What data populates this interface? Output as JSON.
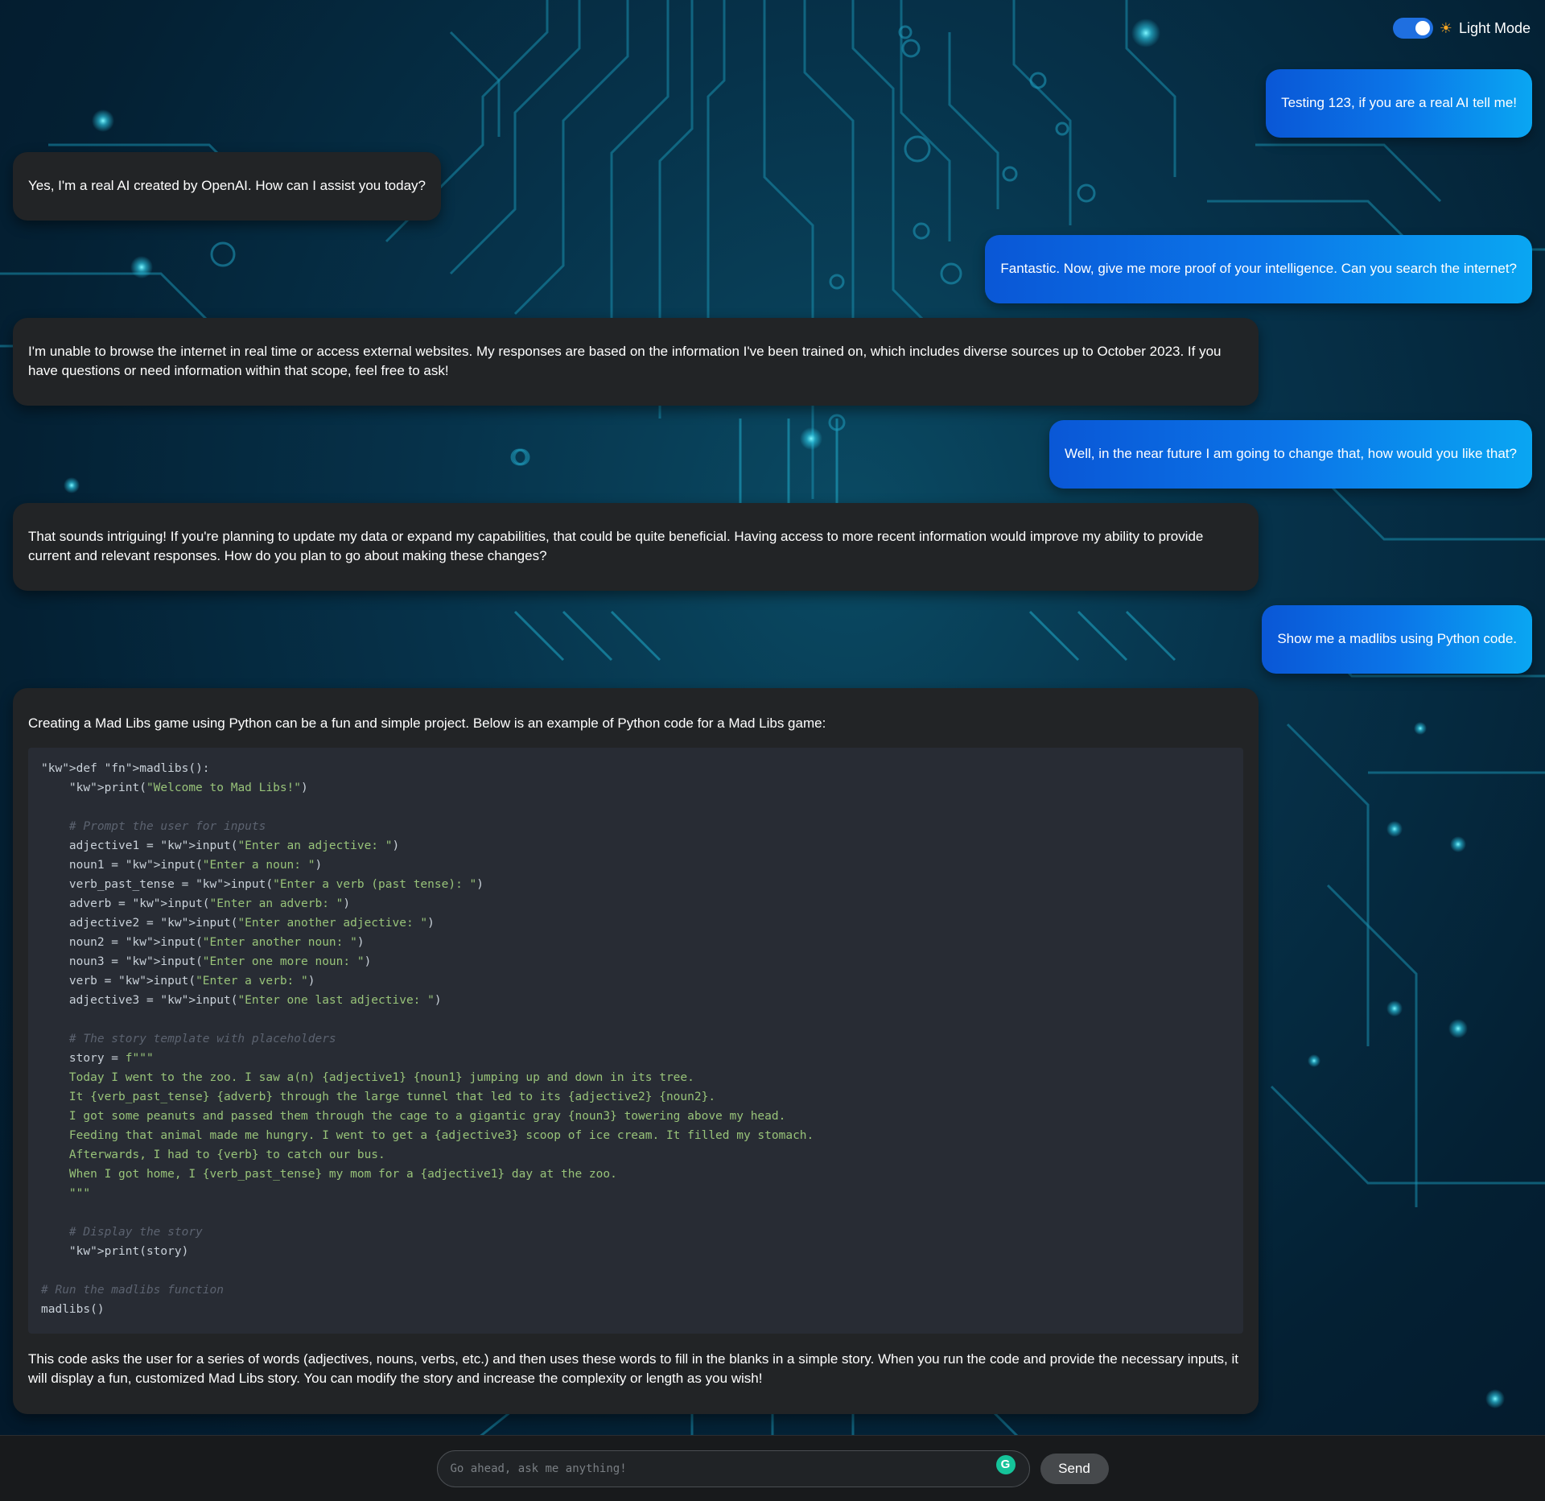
{
  "theme_toggle": {
    "label": "Light Mode",
    "enabled": true,
    "icon": "sun-icon"
  },
  "messages": [
    {
      "role": "user",
      "text": "Testing 123, if you are a real AI tell me!"
    },
    {
      "role": "assistant",
      "text": "Yes, I'm a real AI created by OpenAI. How can I assist you today?"
    },
    {
      "role": "user",
      "text": "Fantastic. Now, give me more proof of your intelligence. Can you search the internet?"
    },
    {
      "role": "assistant",
      "text": "I'm unable to browse the internet in real time or access external websites. My responses are based on the information I've been trained on, which includes diverse sources up to October 2023. If you have questions or need information within that scope, feel free to ask!"
    },
    {
      "role": "user",
      "text": "Well, in the near future I am going to change that, how would you like that?"
    },
    {
      "role": "assistant",
      "text": "That sounds intriguing! If you're planning to update my data or expand my capabilities, that could be quite beneficial. Having access to more recent information would improve my ability to provide current and relevant responses. How do you plan to go about making these changes?"
    },
    {
      "role": "user",
      "text": "Show me a madlibs using Python code."
    }
  ],
  "final_response": {
    "intro": "Creating a Mad Libs game using Python can be a fun and simple project. Below is an example of Python code for a Mad Libs game:",
    "code_lines": [
      "def madlibs():",
      "    print(\"Welcome to Mad Libs!\")",
      "",
      "    # Prompt the user for inputs",
      "    adjective1 = input(\"Enter an adjective: \")",
      "    noun1 = input(\"Enter a noun: \")",
      "    verb_past_tense = input(\"Enter a verb (past tense): \")",
      "    adverb = input(\"Enter an adverb: \")",
      "    adjective2 = input(\"Enter another adjective: \")",
      "    noun2 = input(\"Enter another noun: \")",
      "    noun3 = input(\"Enter one more noun: \")",
      "    verb = input(\"Enter a verb: \")",
      "    adjective3 = input(\"Enter one last adjective: \")",
      "",
      "    # The story template with placeholders",
      "    story = f\"\"\"",
      "    Today I went to the zoo. I saw a(n) {adjective1} {noun1} jumping up and down in its tree.",
      "    It {verb_past_tense} {adverb} through the large tunnel that led to its {adjective2} {noun2}.",
      "    I got some peanuts and passed them through the cage to a gigantic gray {noun3} towering above my head.",
      "    Feeding that animal made me hungry. I went to get a {adjective3} scoop of ice cream. It filled my stomach.",
      "    Afterwards, I had to {verb} to catch our bus.",
      "    When I got home, I {verb_past_tense} my mom for a {adjective1} day at the zoo.",
      "    \"\"\"",
      "",
      "    # Display the story",
      "    print(story)",
      "",
      "# Run the madlibs function",
      "madlibs()"
    ],
    "outro": "This code asks the user for a series of words (adjectives, nouns, verbs, etc.) and then uses these words to fill in the blanks in a simple story. When you run the code and provide the necessary inputs, it will display a fun, customized Mad Libs story. You can modify the story and increase the complexity or length as you wish!"
  },
  "composer": {
    "placeholder": "Go ahead, ask me anything!",
    "value": "",
    "send_label": "Send",
    "extension_icon": "grammarly-icon"
  },
  "colors": {
    "user_bubble_start": "#0a57d6",
    "user_bubble_end": "#0aa6f2",
    "assistant_bubble": "#222426",
    "code_background": "#282c34",
    "send_button": "#46494c",
    "toggle_on": "#1f6fe0"
  }
}
